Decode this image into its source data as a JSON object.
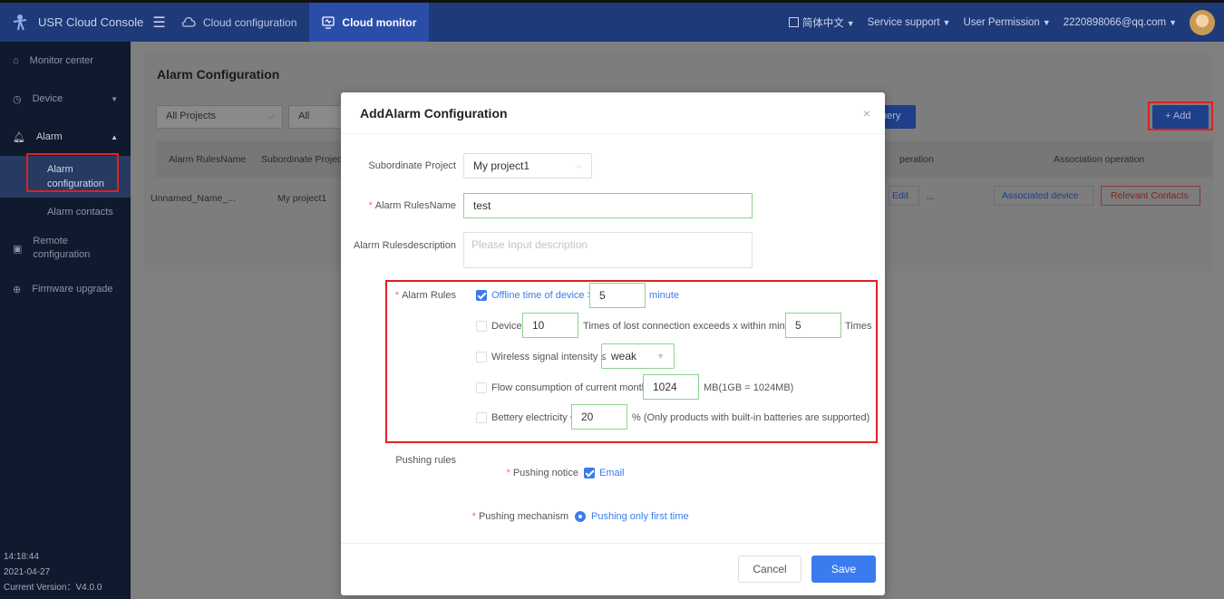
{
  "topbar": {
    "brand": "USR Cloud Console",
    "tabs": [
      {
        "label": "Cloud configuration"
      },
      {
        "label": "Cloud monitor"
      }
    ],
    "language": "简体中文",
    "service_support": "Service support",
    "user_permission": "User Permission",
    "user_email": "2220898066@qq.com"
  },
  "sidebar": {
    "items": {
      "monitor_center": "Monitor center",
      "device": "Device",
      "alarm": "Alarm",
      "alarm_configuration_line1": "Alarm",
      "alarm_configuration_line2": "configuration",
      "alarm_contacts": "Alarm contacts",
      "remote_line1": "Remote",
      "remote_line2": "configuration",
      "firmware_upgrade": "Firmware upgrade"
    },
    "footer": {
      "time": "14:18:44",
      "date": "2021-04-27",
      "version": "Current Version：V4.0.0"
    }
  },
  "background": {
    "title": "Alarm Configuration",
    "filter_project": "All Projects",
    "filter_all": "All",
    "query_partial": "uery",
    "add_button": "+ Add",
    "columns": {
      "rules_name": "Alarm RulesName",
      "subordinate": "Subordinate Project",
      "operation_partial": "peration",
      "association": "Association operation"
    },
    "row": {
      "name": "Unnamed_Name_...",
      "project": "My project1",
      "edit": "Edit",
      "more": "...",
      "associated_device": "Associated device",
      "relevant_contacts": "Relevant Contacts"
    }
  },
  "modal": {
    "title": "AddAlarm Configuration",
    "close": "×",
    "subordinate_label": "Subordinate Project",
    "subordinate_value": "My project1",
    "rules_name_label": "Alarm RulesName",
    "rules_name_value": "test",
    "description_label": "Alarm Rulesdescription",
    "description_placeholder": "Please Input description",
    "alarm_rules_label": "Alarm Rules",
    "rules": {
      "offline_text": "Offline time of device  >",
      "offline_value": "5",
      "offline_unit": "minute",
      "device_text": "Device",
      "device_value": "10",
      "lost_text": "Times of lost connection exceeds x within minutes",
      "lost_value": "5",
      "lost_unit": "Times",
      "signal_text": "Wireless signal intensity ≤",
      "signal_value": "weak",
      "flow_text": "Flow consumption of current month >",
      "flow_value": "1024",
      "flow_unit": "MB(1GB = 1024MB)",
      "battery_text": "Bettery electricity <",
      "battery_value": "20",
      "battery_unit": "%  (Only products with built-in batteries are supported)"
    },
    "pushing_rules_label": "Pushing rules",
    "pushing_notice_label": "Pushing notice",
    "pushing_notice_value": "Email",
    "pushing_mechanism_label": "Pushing mechanism",
    "pushing_mechanism_value": "Pushing only first time",
    "cancel": "Cancel",
    "save": "Save"
  }
}
